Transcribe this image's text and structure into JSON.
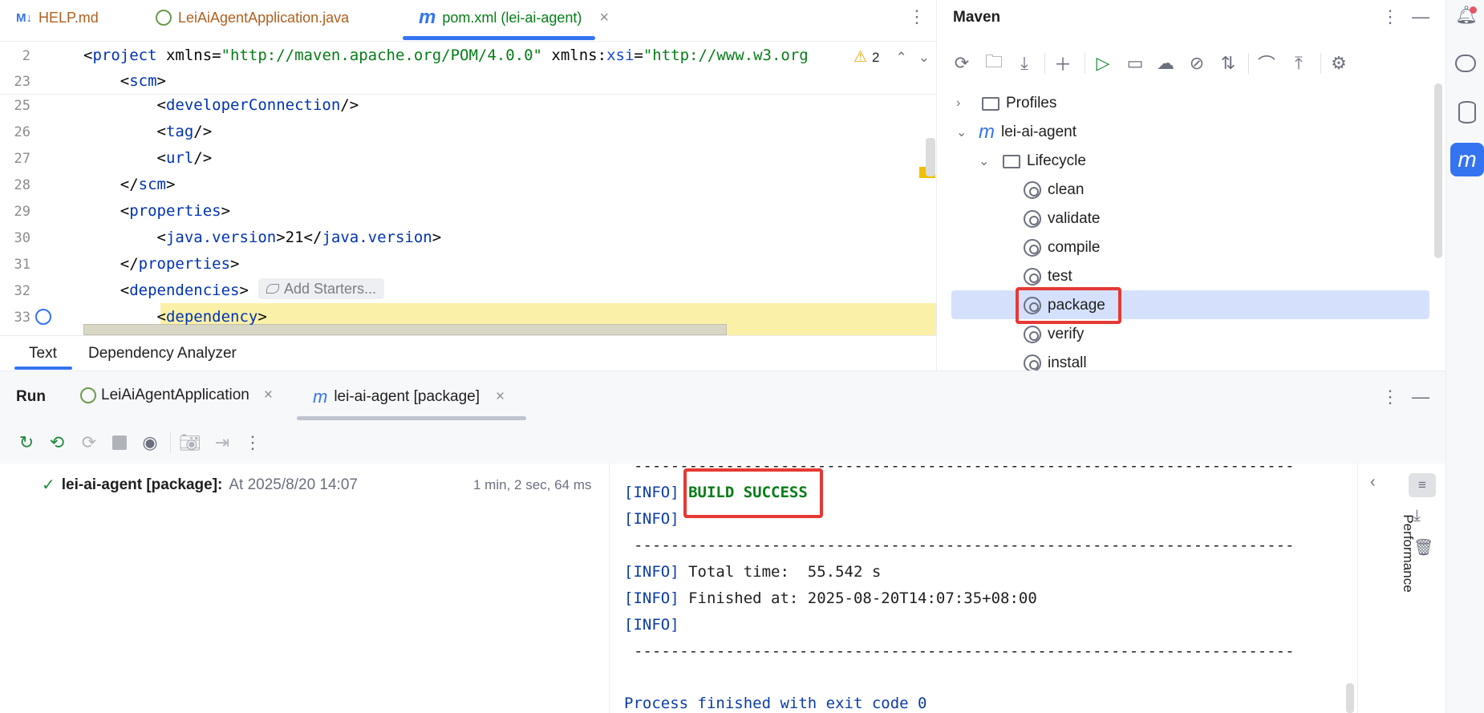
{
  "editor_tabs": [
    {
      "label": "HELP.md",
      "icon": "M↓",
      "color": "#b06020"
    },
    {
      "label": "LeiAiAgentApplication.java",
      "icon": "spring",
      "color": "#b06020"
    },
    {
      "label": "pom.xml (lei-ai-agent)",
      "icon": "m",
      "color": "#067d17"
    }
  ],
  "editor": {
    "warning_count": "2",
    "line_numbers": [
      "2",
      "23",
      "25",
      "26",
      "27",
      "28",
      "29",
      "30",
      "31",
      "32",
      "33"
    ],
    "lines": [
      {
        "parts": [
          [
            "brk",
            "<"
          ],
          [
            "tag",
            "project"
          ],
          [
            "brk",
            " xmlns="
          ],
          [
            "str",
            "\"http://maven.apache.org/POM/4.0.0\""
          ],
          [
            "brk",
            " xmlns:"
          ],
          [
            "attr",
            "xsi"
          ],
          [
            "brk",
            "="
          ],
          [
            "str",
            "\"http://www.w3.org"
          ]
        ]
      },
      {
        "parts": [
          [
            "brk",
            "    <"
          ],
          [
            "tag",
            "scm"
          ],
          [
            "brk",
            ">"
          ]
        ]
      },
      {
        "parts": [
          [
            "brk",
            "        <"
          ],
          [
            "tag",
            "developerConnection"
          ],
          [
            "brk",
            "/>"
          ]
        ]
      },
      {
        "parts": [
          [
            "brk",
            "        <"
          ],
          [
            "tag",
            "tag"
          ],
          [
            "brk",
            "/>"
          ]
        ]
      },
      {
        "parts": [
          [
            "brk",
            "        <"
          ],
          [
            "tag",
            "url"
          ],
          [
            "brk",
            "/>"
          ]
        ]
      },
      {
        "parts": [
          [
            "brk",
            "    </"
          ],
          [
            "tag",
            "scm"
          ],
          [
            "brk",
            ">"
          ]
        ]
      },
      {
        "parts": [
          [
            "brk",
            "    <"
          ],
          [
            "tag",
            "properties"
          ],
          [
            "brk",
            ">"
          ]
        ]
      },
      {
        "parts": [
          [
            "brk",
            "        <"
          ],
          [
            "tag",
            "java.version"
          ],
          [
            "brk",
            ">21</"
          ],
          [
            "tag",
            "java.version"
          ],
          [
            "brk",
            ">"
          ]
        ]
      },
      {
        "parts": [
          [
            "brk",
            "    </"
          ],
          [
            "tag",
            "properties"
          ],
          [
            "brk",
            ">"
          ]
        ]
      },
      {
        "parts": [
          [
            "brk",
            "    <"
          ],
          [
            "tag",
            "dependencies"
          ],
          [
            "brk",
            ">"
          ]
        ]
      },
      {
        "parts": [
          [
            "brk",
            "        <"
          ],
          [
            "tag",
            "dependency"
          ],
          [
            "brk",
            ">"
          ]
        ]
      }
    ],
    "add_starters_label": "Add Starters...",
    "bottom_tabs": [
      "Text",
      "Dependency Analyzer"
    ]
  },
  "maven": {
    "title": "Maven",
    "tree": {
      "profiles": "Profiles",
      "project": "lei-ai-agent",
      "lifecycle": "Lifecycle",
      "phases": [
        "clean",
        "validate",
        "compile",
        "test",
        "package",
        "verify",
        "install"
      ],
      "selected": "package"
    }
  },
  "run": {
    "title": "Run",
    "tabs": [
      {
        "label": "LeiAiAgentApplication"
      },
      {
        "label": "lei-ai-agent [package]"
      }
    ],
    "tree_item": {
      "name": "lei-ai-agent [package]:",
      "time": "At 2025/8/20 14:07",
      "duration": "1 min, 2 sec, 64 ms"
    },
    "console": {
      "separator": "------------------------------------------------------------------------",
      "lines": [
        {
          "prefix": "[INFO]",
          "text": " BUILD SUCCESS",
          "style": "success"
        },
        {
          "prefix": "[INFO]",
          "text": ""
        },
        {
          "prefix": "[INFO]",
          "text": " Total time:  55.542 s"
        },
        {
          "prefix": "[INFO]",
          "text": " Finished at: 2025-08-20T14:07:35+08:00"
        },
        {
          "prefix": "[INFO]",
          "text": ""
        }
      ],
      "exit_text": "Process finished with exit code 0"
    },
    "performance_label": "Performance"
  }
}
